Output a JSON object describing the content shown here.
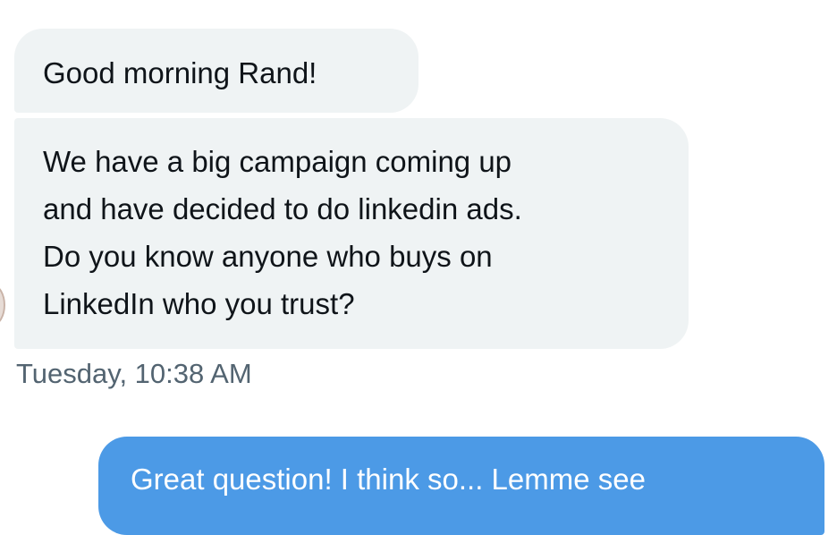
{
  "conversation": {
    "messages": [
      {
        "direction": "incoming",
        "text": "Good morning Rand!"
      },
      {
        "direction": "incoming",
        "lines": [
          "We have a big campaign coming up",
          "and have decided to do linkedin ads.",
          "Do you know anyone who buys on",
          "LinkedIn who you trust?"
        ]
      }
    ],
    "timestamp": "Tuesday, 10:38 AM",
    "reply": {
      "direction": "outgoing",
      "text": "Great question! I think so... Lemme see"
    }
  },
  "colors": {
    "incoming_bubble": "#eff3f4",
    "outgoing_bubble": "#4c9ae6",
    "timestamp_text": "#536471",
    "message_text": "#0f1419"
  }
}
